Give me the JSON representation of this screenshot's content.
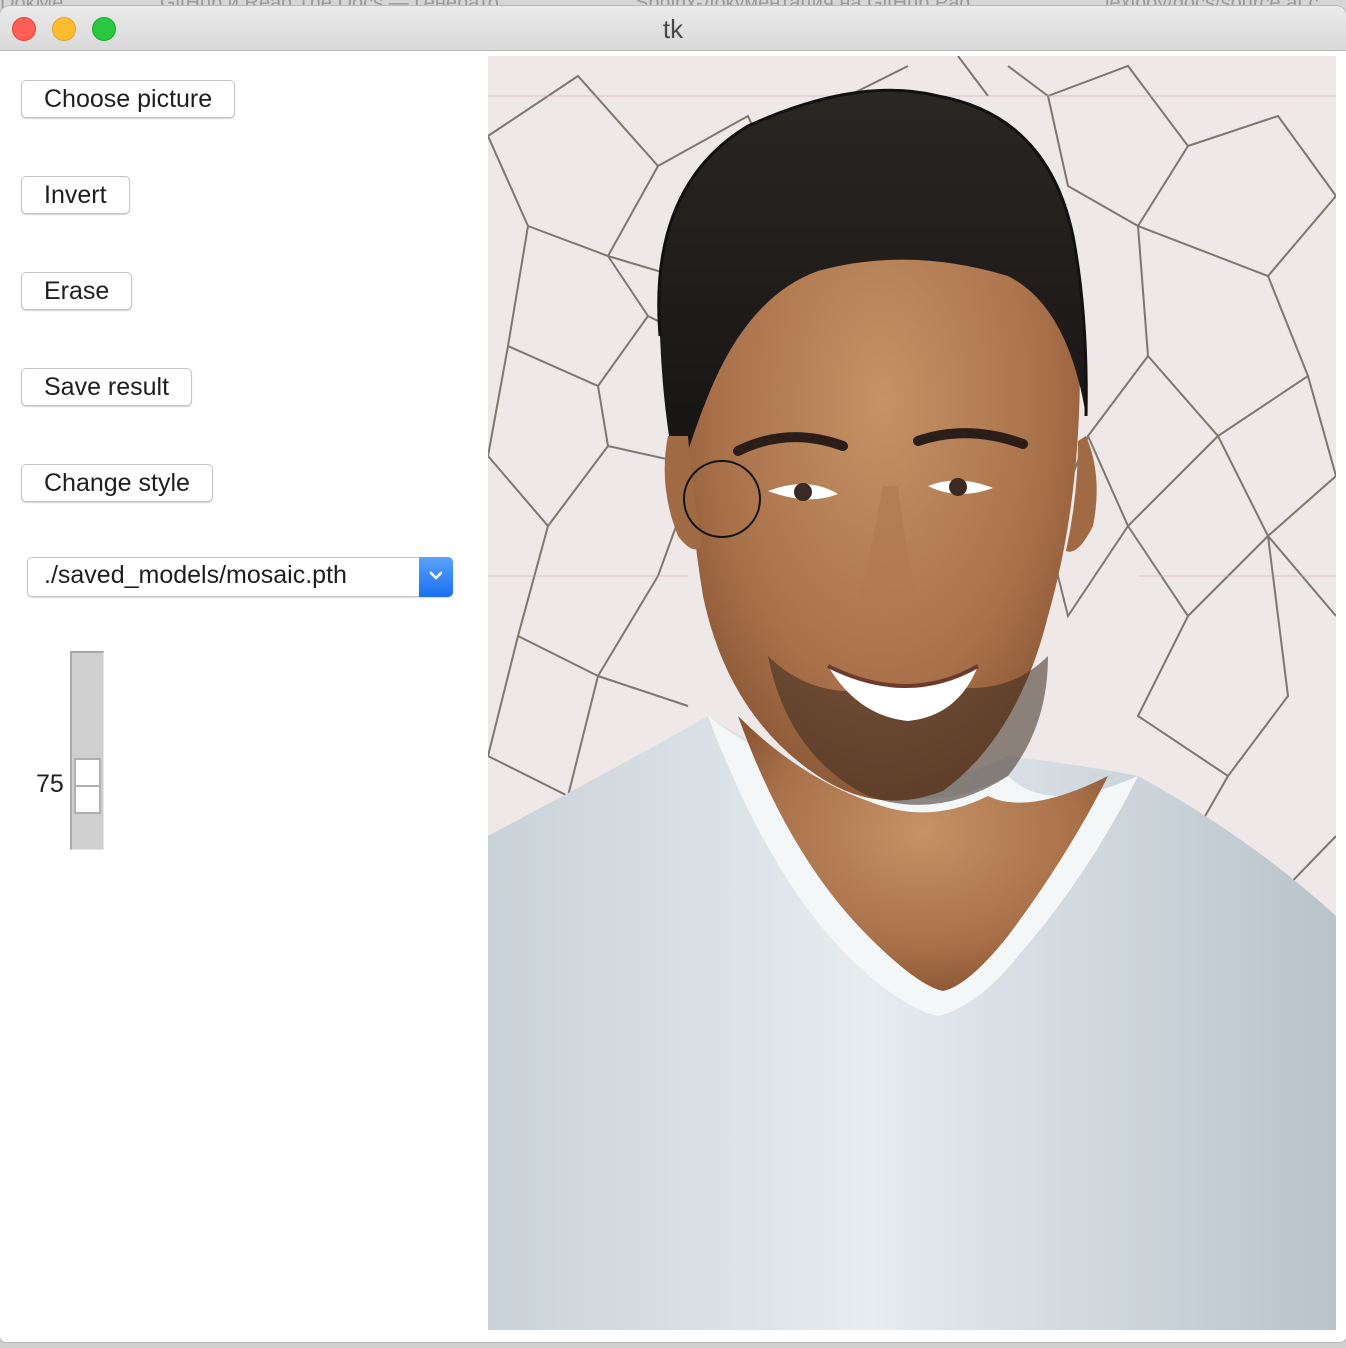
{
  "background_tabs": [
    "DokMe",
    "GitHub и Read The Docs — Генерато",
    "Sphinx-документация на GitHub Pag",
    "lexiboy/docs/source at c"
  ],
  "window": {
    "title": "tk"
  },
  "buttons": {
    "choose_picture": "Choose picture",
    "invert": "Invert",
    "erase": "Erase",
    "save_result": "Save result",
    "change_style": "Change style"
  },
  "model_select": {
    "value": "./saved_models/mosaic.pth"
  },
  "brush_scale": {
    "value": "75",
    "level_fraction": 0.55
  },
  "canvas": {
    "content": "stylized portrait photo",
    "brush_cursor": "circle"
  },
  "colors": {
    "accent": "#1c6ff2",
    "traffic_close": "#fe5f57",
    "traffic_min": "#febc2e",
    "traffic_max": "#28c840"
  },
  "icons": {
    "select_arrow": "chevron-down-icon",
    "cursor": "brush-circle-icon"
  }
}
